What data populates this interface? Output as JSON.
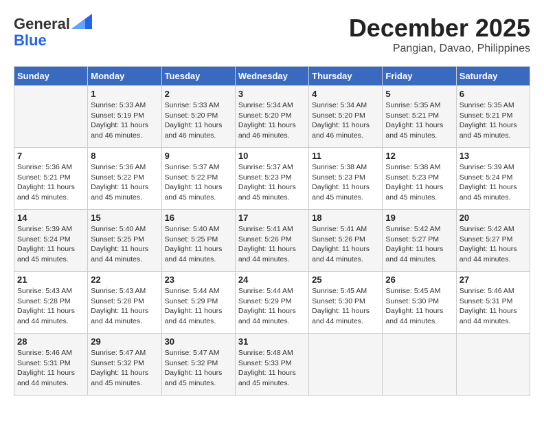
{
  "header": {
    "logo_line1": "General",
    "logo_line2": "Blue",
    "month": "December 2025",
    "location": "Pangian, Davao, Philippines"
  },
  "days_of_week": [
    "Sunday",
    "Monday",
    "Tuesday",
    "Wednesday",
    "Thursday",
    "Friday",
    "Saturday"
  ],
  "weeks": [
    [
      {
        "day": "",
        "info": ""
      },
      {
        "day": "1",
        "info": "Sunrise: 5:33 AM\nSunset: 5:19 PM\nDaylight: 11 hours\nand 46 minutes."
      },
      {
        "day": "2",
        "info": "Sunrise: 5:33 AM\nSunset: 5:20 PM\nDaylight: 11 hours\nand 46 minutes."
      },
      {
        "day": "3",
        "info": "Sunrise: 5:34 AM\nSunset: 5:20 PM\nDaylight: 11 hours\nand 46 minutes."
      },
      {
        "day": "4",
        "info": "Sunrise: 5:34 AM\nSunset: 5:20 PM\nDaylight: 11 hours\nand 46 minutes."
      },
      {
        "day": "5",
        "info": "Sunrise: 5:35 AM\nSunset: 5:21 PM\nDaylight: 11 hours\nand 45 minutes."
      },
      {
        "day": "6",
        "info": "Sunrise: 5:35 AM\nSunset: 5:21 PM\nDaylight: 11 hours\nand 45 minutes."
      }
    ],
    [
      {
        "day": "7",
        "info": "Sunrise: 5:36 AM\nSunset: 5:21 PM\nDaylight: 11 hours\nand 45 minutes."
      },
      {
        "day": "8",
        "info": "Sunrise: 5:36 AM\nSunset: 5:22 PM\nDaylight: 11 hours\nand 45 minutes."
      },
      {
        "day": "9",
        "info": "Sunrise: 5:37 AM\nSunset: 5:22 PM\nDaylight: 11 hours\nand 45 minutes."
      },
      {
        "day": "10",
        "info": "Sunrise: 5:37 AM\nSunset: 5:23 PM\nDaylight: 11 hours\nand 45 minutes."
      },
      {
        "day": "11",
        "info": "Sunrise: 5:38 AM\nSunset: 5:23 PM\nDaylight: 11 hours\nand 45 minutes."
      },
      {
        "day": "12",
        "info": "Sunrise: 5:38 AM\nSunset: 5:23 PM\nDaylight: 11 hours\nand 45 minutes."
      },
      {
        "day": "13",
        "info": "Sunrise: 5:39 AM\nSunset: 5:24 PM\nDaylight: 11 hours\nand 45 minutes."
      }
    ],
    [
      {
        "day": "14",
        "info": "Sunrise: 5:39 AM\nSunset: 5:24 PM\nDaylight: 11 hours\nand 45 minutes."
      },
      {
        "day": "15",
        "info": "Sunrise: 5:40 AM\nSunset: 5:25 PM\nDaylight: 11 hours\nand 44 minutes."
      },
      {
        "day": "16",
        "info": "Sunrise: 5:40 AM\nSunset: 5:25 PM\nDaylight: 11 hours\nand 44 minutes."
      },
      {
        "day": "17",
        "info": "Sunrise: 5:41 AM\nSunset: 5:26 PM\nDaylight: 11 hours\nand 44 minutes."
      },
      {
        "day": "18",
        "info": "Sunrise: 5:41 AM\nSunset: 5:26 PM\nDaylight: 11 hours\nand 44 minutes."
      },
      {
        "day": "19",
        "info": "Sunrise: 5:42 AM\nSunset: 5:27 PM\nDaylight: 11 hours\nand 44 minutes."
      },
      {
        "day": "20",
        "info": "Sunrise: 5:42 AM\nSunset: 5:27 PM\nDaylight: 11 hours\nand 44 minutes."
      }
    ],
    [
      {
        "day": "21",
        "info": "Sunrise: 5:43 AM\nSunset: 5:28 PM\nDaylight: 11 hours\nand 44 minutes."
      },
      {
        "day": "22",
        "info": "Sunrise: 5:43 AM\nSunset: 5:28 PM\nDaylight: 11 hours\nand 44 minutes."
      },
      {
        "day": "23",
        "info": "Sunrise: 5:44 AM\nSunset: 5:29 PM\nDaylight: 11 hours\nand 44 minutes."
      },
      {
        "day": "24",
        "info": "Sunrise: 5:44 AM\nSunset: 5:29 PM\nDaylight: 11 hours\nand 44 minutes."
      },
      {
        "day": "25",
        "info": "Sunrise: 5:45 AM\nSunset: 5:30 PM\nDaylight: 11 hours\nand 44 minutes."
      },
      {
        "day": "26",
        "info": "Sunrise: 5:45 AM\nSunset: 5:30 PM\nDaylight: 11 hours\nand 44 minutes."
      },
      {
        "day": "27",
        "info": "Sunrise: 5:46 AM\nSunset: 5:31 PM\nDaylight: 11 hours\nand 44 minutes."
      }
    ],
    [
      {
        "day": "28",
        "info": "Sunrise: 5:46 AM\nSunset: 5:31 PM\nDaylight: 11 hours\nand 44 minutes."
      },
      {
        "day": "29",
        "info": "Sunrise: 5:47 AM\nSunset: 5:32 PM\nDaylight: 11 hours\nand 45 minutes."
      },
      {
        "day": "30",
        "info": "Sunrise: 5:47 AM\nSunset: 5:32 PM\nDaylight: 11 hours\nand 45 minutes."
      },
      {
        "day": "31",
        "info": "Sunrise: 5:48 AM\nSunset: 5:33 PM\nDaylight: 11 hours\nand 45 minutes."
      },
      {
        "day": "",
        "info": ""
      },
      {
        "day": "",
        "info": ""
      },
      {
        "day": "",
        "info": ""
      }
    ]
  ]
}
